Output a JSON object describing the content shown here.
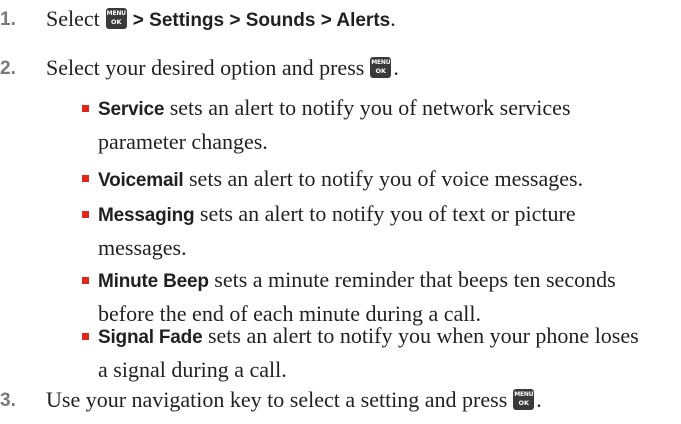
{
  "steps": [
    {
      "number": "1.",
      "prefix": "Select",
      "key_top": "MENU",
      "key_bottom": "OK",
      "path": "> Settings > Sounds > Alerts",
      "suffix": "."
    },
    {
      "number": "2.",
      "text": "Select your desired option and press",
      "key_top": "MENU",
      "key_bottom": "OK",
      "suffix": "."
    },
    {
      "number": "3.",
      "text": "Use your navigation key to select a setting and press",
      "key_top": "MENU",
      "key_bottom": "OK",
      "suffix": "."
    }
  ],
  "options": [
    {
      "term": "Service",
      "line1": " sets an alert to notify you of network services",
      "line2": "parameter changes."
    },
    {
      "term": "Voicemail",
      "line1": " sets an alert to notify you of voice messages.",
      "line2": ""
    },
    {
      "term": "Messaging",
      "line1": " sets an alert to notify you of text or picture",
      "line2": "messages."
    },
    {
      "term": "Minute Beep",
      "line1": " sets a minute reminder that beeps ten seconds",
      "line2": "before the end of each minute during a call."
    },
    {
      "term": "Signal Fade",
      "line1": " sets an alert to notify you when your phone loses",
      "line2": "a signal during a call."
    }
  ],
  "colors": {
    "text": "#231f20",
    "step_number": "#7a7a7a",
    "bullet": "#e1261c",
    "key_background": "#3a3a3a"
  }
}
